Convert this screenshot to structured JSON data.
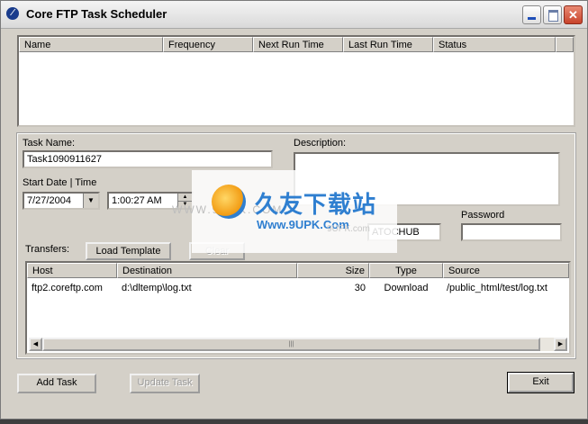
{
  "window": {
    "title": "Core FTP Task Scheduler",
    "icon": "core-ftp-icon",
    "controls": {
      "minimize": "minimize-icon",
      "maximize": "maximize-icon",
      "close": "✕"
    }
  },
  "tasks_list": {
    "columns": [
      "Name",
      "Frequency",
      "Next Run Time",
      "Last Run Time",
      "Status"
    ],
    "rows": []
  },
  "form": {
    "task_name_label": "Task Name:",
    "task_name_value": "Task1090911627",
    "description_label": "Description:",
    "description_value": "",
    "start_label": "Start Date | Time",
    "start_date": "7/27/2004",
    "start_time": "1:00:27 AM",
    "site_value": "ATOCHUB",
    "password_label": "Password",
    "password_value": "",
    "transfers_label": "Transfers:",
    "load_template_label": "Load Template",
    "clear_label": "Clear"
  },
  "transfers": {
    "columns": [
      "Host",
      "Destination",
      "Size",
      "Type",
      "Source"
    ],
    "rows": [
      {
        "host": "ftp2.coreftp.com",
        "destination": "d:\\dltemp\\log.txt",
        "size": "30",
        "type": "Download",
        "source": "/public_html/test/log.txt"
      }
    ],
    "scroll_grip": "|||"
  },
  "buttons": {
    "add_task": "Add Task",
    "update_task": "Update Task",
    "exit": "Exit"
  },
  "watermark": {
    "title": "久友下载站",
    "url": "Www.9UPK.Com",
    "faint_url": "WWW.9UPK.COM",
    "faint_small": "9UPK.com"
  }
}
